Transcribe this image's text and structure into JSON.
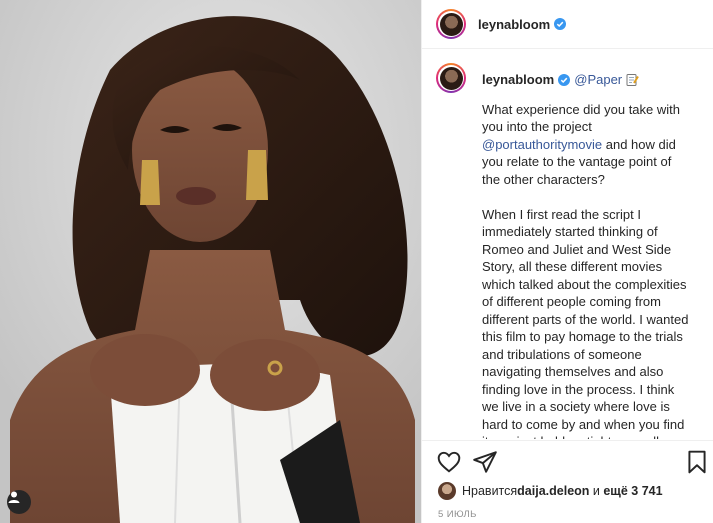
{
  "post": {
    "username": "leynabloom",
    "caption_mention": "@Paper",
    "caption_emoji": "memo-emoji",
    "caption_p1_a": "What experience did you take with you into the project ",
    "caption_p1_mention": "@portauthoritymovie",
    "caption_p1_b": " and how did you relate to the vantage point of the other characters?",
    "caption_p2": "When I first read the script I immediately started thinking of Romeo and Juliet and West Side Story, all these different movies which talked about the complexities of different people coming from different parts of the world. I wanted this film to pay homage to the trials and tribulations of someone navigating themselves and also finding love in the process. I think we live in a society where love is hard to come by and when you find it you just hold on tight, regardless of gender regardless of sexuality. There's something really human about people",
    "likes_prefix": "Нравится ",
    "likes_user": "daija.deleon",
    "likes_mid": " и ",
    "likes_count": "ещё 3 741",
    "date": "5 ИЮЛЬ"
  },
  "colors": {
    "link": "#385898",
    "verified": "#3897f0",
    "text": "#262626",
    "muted": "#8e8e8e"
  },
  "icons": [
    "verified-badge-icon",
    "heart-icon",
    "share-icon",
    "bookmark-icon",
    "user-tag-icon"
  ]
}
